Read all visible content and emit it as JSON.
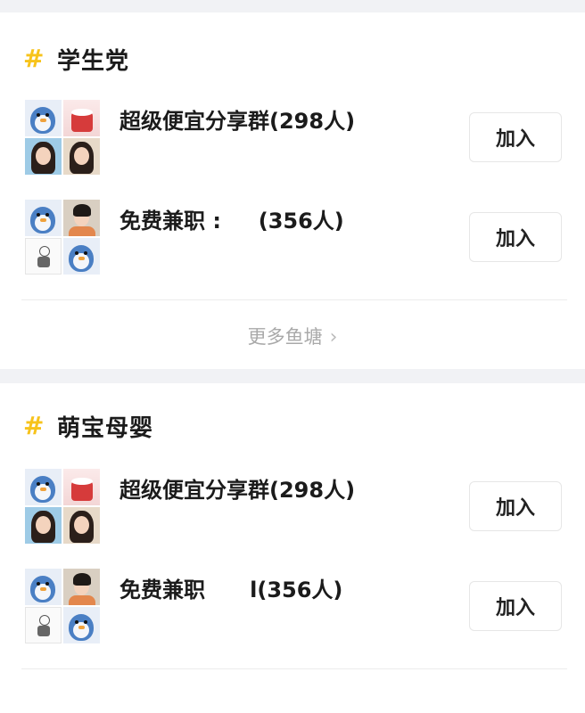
{
  "sections": [
    {
      "title": "学生党",
      "groups": [
        {
          "name": "超级便宜分享群(298人)",
          "join_label": "加入"
        },
        {
          "name": "免费兼职 :     (356人)",
          "join_label": "加入"
        }
      ],
      "more_label": "更多鱼塘"
    },
    {
      "title": "萌宝母婴",
      "groups": [
        {
          "name": "超级便宜分享群(298人)",
          "join_label": "加入"
        },
        {
          "name": "免费兼职      l(356人)",
          "join_label": "加入"
        }
      ]
    }
  ],
  "colors": {
    "hash_accent": "#f7c31b",
    "background": "#f1f2f5",
    "card": "#ffffff"
  },
  "icons": {
    "section": "hash-icon",
    "more": "chevron-right-icon"
  }
}
